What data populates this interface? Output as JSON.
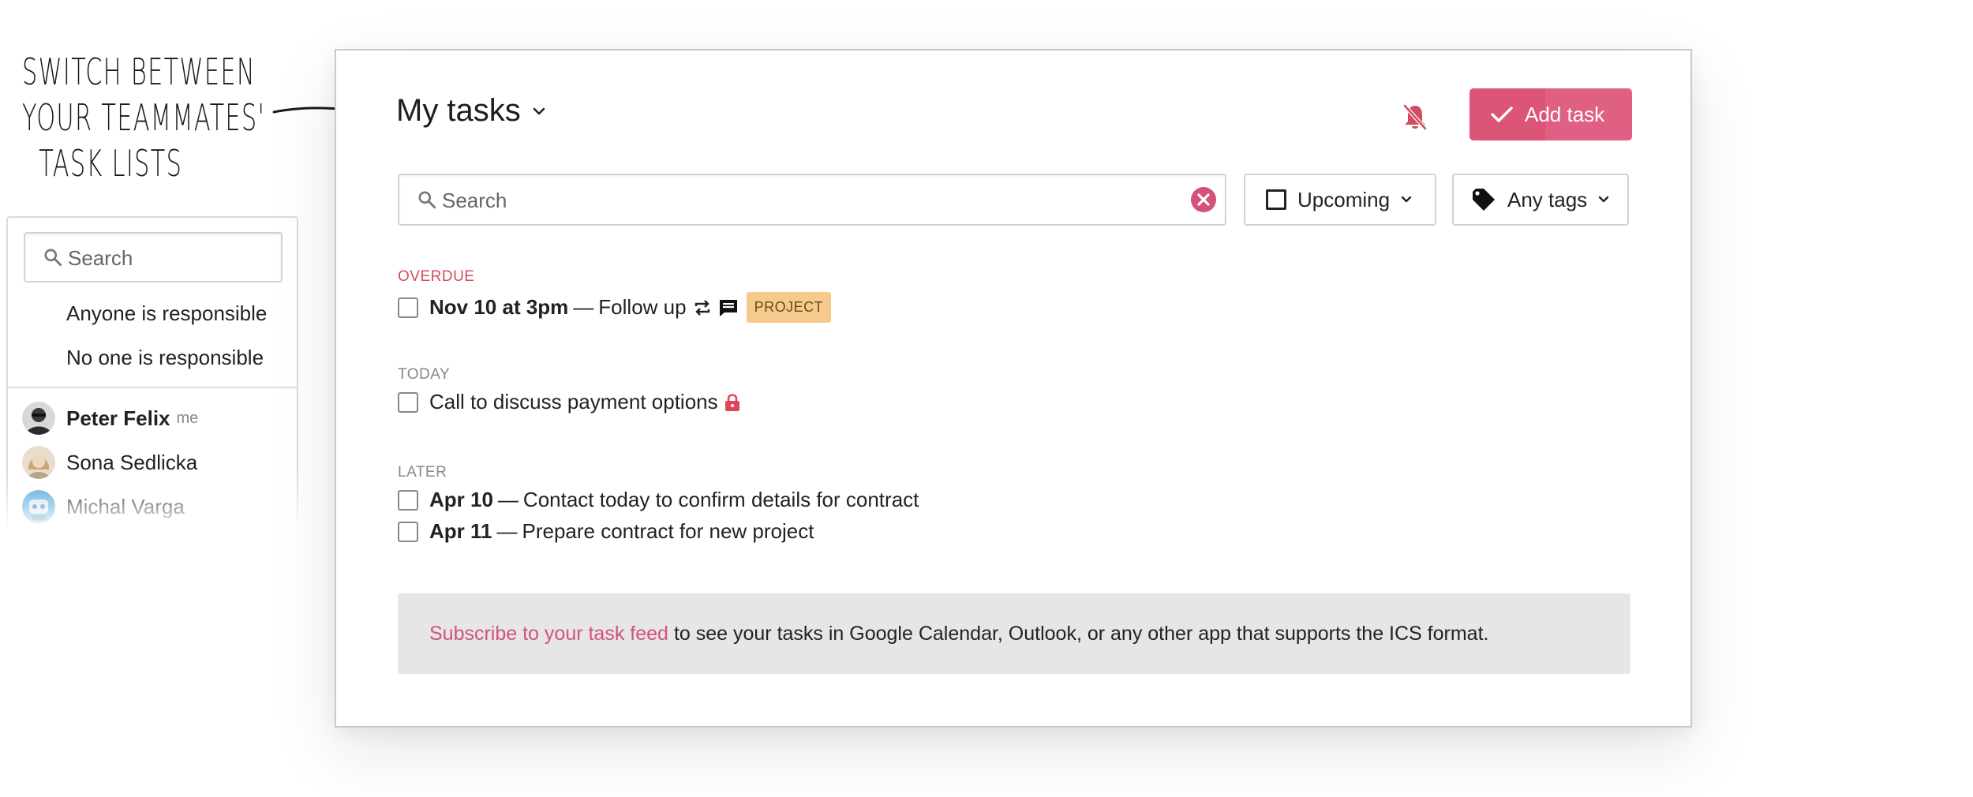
{
  "annotation": {
    "lines": [
      "Switch between",
      "your teammates'",
      "task lists"
    ]
  },
  "assignee_panel": {
    "search_placeholder": "Search",
    "options": [
      "Anyone is responsible",
      "No one is responsible"
    ],
    "people": [
      {
        "name": "Peter Felix",
        "tag": "me"
      },
      {
        "name": "Sona Sedlicka",
        "tag": ""
      },
      {
        "name": "Michal Varga",
        "tag": ""
      }
    ]
  },
  "header": {
    "title": "My tasks",
    "add_button": "Add task"
  },
  "filters": {
    "search_placeholder": "Search",
    "date_filter": "Upcoming",
    "tag_filter": "Any tags"
  },
  "sections": {
    "overdue": {
      "label": "OVERDUE",
      "tasks": [
        {
          "date": "Nov 10 at 3pm",
          "separator": "—",
          "text": "Follow up",
          "badge": "PROJECT"
        }
      ]
    },
    "today": {
      "label": "TODAY",
      "tasks": [
        {
          "text": "Call to discuss payment options"
        }
      ]
    },
    "later": {
      "label": "LATER",
      "tasks": [
        {
          "date": "Apr 10",
          "separator": "—",
          "text": "Contact today to confirm details for contract"
        },
        {
          "date": "Apr 11",
          "separator": "—",
          "text": "Prepare contract for new project"
        }
      ]
    }
  },
  "feed": {
    "link_text": "Subscribe to your task feed",
    "rest_text": "to see your tasks in Google Calendar, Outlook, or any other app that supports the ICS format."
  },
  "colors": {
    "accent": "#dd5479",
    "overdue": "#d24b5e",
    "badge_bg": "#f6c98c",
    "lock": "#e0455b"
  }
}
